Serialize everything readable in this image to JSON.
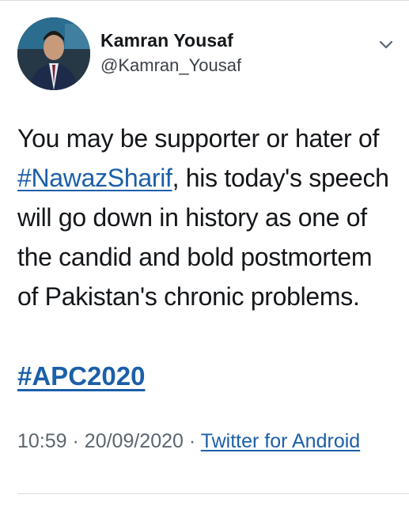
{
  "tweet": {
    "author_name": "Kamran Yousaf",
    "author_handle": "@Kamran_Yousaf",
    "text_before": "You may be supporter or hater of ",
    "hashtag_inline": "#NawazSharif",
    "text_after": ", his today's speech will go down in history as one of the candid and bold postmortem of Pakistan's chronic problems.",
    "hashtag_line": "#APC2020",
    "time": "10:59",
    "separator": "·",
    "date": "20/09/2020",
    "source": "Twitter for Android"
  },
  "icons": {
    "more": "chevron-down-icon",
    "avatar": "avatar-photo"
  },
  "colors": {
    "link": "#1b5fa8",
    "text": "#14171a",
    "meta": "#5b6670",
    "divider": "#d8dde1"
  }
}
